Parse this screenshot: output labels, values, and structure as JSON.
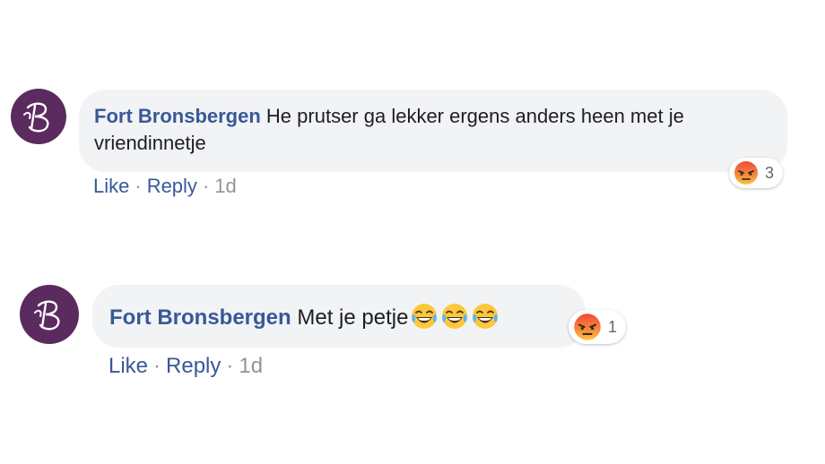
{
  "comments": [
    {
      "author": "Fort Bronsbergen",
      "text": "He prutser ga lekker ergens anders heen met je vriendinnetje",
      "reaction_icon": "angry-face-icon",
      "reaction_count": "3",
      "like_label": "Like",
      "reply_label": "Reply",
      "separator": "·",
      "time": "1d"
    },
    {
      "author": "Fort Bronsbergen",
      "text": "Met je petje",
      "trailing_emoji": [
        "laughing-tears-icon",
        "laughing-tears-icon",
        "laughing-tears-icon"
      ],
      "reaction_icon": "angry-face-icon",
      "reaction_count": "1",
      "like_label": "Like",
      "reply_label": "Reply",
      "separator": "·",
      "time": "1d"
    }
  ],
  "colors": {
    "author_link": "#385898",
    "bubble_bg": "#f2f3f5",
    "avatar_bg": "#5b2a5e",
    "meta_text": "#90949c"
  }
}
